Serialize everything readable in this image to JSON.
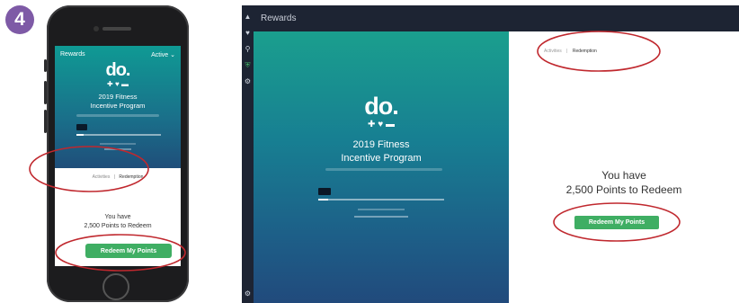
{
  "step": {
    "number": "4",
    "color": "#7e5aa6"
  },
  "colors": {
    "hero_top": "#1a9f8e",
    "hero_bottom": "#214a7c",
    "button": "#3fae63",
    "callout": "#c0282e",
    "sidebar": "#1d2433"
  },
  "mobile": {
    "header": {
      "title": "Rewards",
      "status": "Active",
      "status_icon": "chevron-down-icon"
    },
    "logo": "do.",
    "logo_icons": [
      "cross-icon",
      "shield-icon",
      "dash-icon"
    ],
    "program_title_line1": "2019 Fitness",
    "program_title_line2": "Incentive Program",
    "tabs": [
      "Activities",
      "Redemption"
    ],
    "points_line1": "You have",
    "points_line2": "2,500 Points to Redeem",
    "redeem_button": "Redeem My Points",
    "progress_fraction": 0.08
  },
  "desktop": {
    "window_title": "Rewards",
    "sidebar_icons": [
      "home-icon",
      "heart-icon",
      "search-icon",
      "shield-icon",
      "gear-icon"
    ],
    "logo": "do.",
    "logo_icons": [
      "cross-icon",
      "shield-icon",
      "dash-icon"
    ],
    "program_title_line1": "2019 Fitness",
    "program_title_line2": "Incentive Program",
    "tabs": [
      "Activities",
      "Redemption"
    ],
    "points_line1": "You have",
    "points_line2": "2,500 Points to Redeem",
    "redeem_button": "Redeem My Points",
    "progress_fraction": 0.08
  }
}
